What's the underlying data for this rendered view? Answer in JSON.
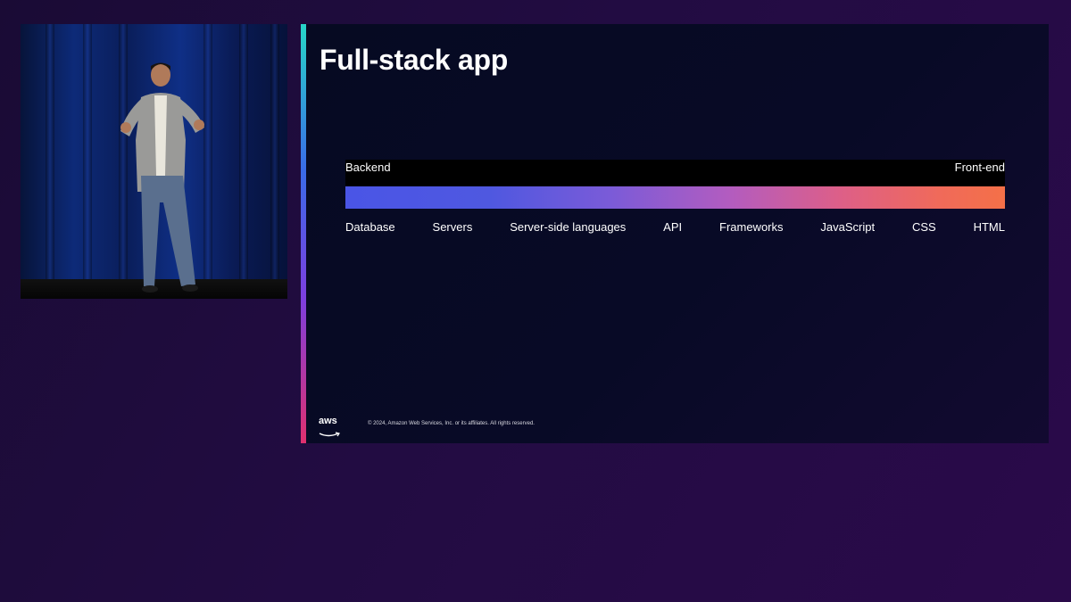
{
  "slide": {
    "title": "Full-stack app",
    "spectrum": {
      "left_label": "Backend",
      "right_label": "Front-end",
      "layers": [
        "Database",
        "Servers",
        "Server-side languages",
        "API",
        "Frameworks",
        "JavaScript",
        "CSS",
        "HTML"
      ]
    },
    "footer": {
      "logo_text": "aws",
      "copyright": "© 2024, Amazon Web Services, Inc. or its affiliates. All rights reserved."
    }
  },
  "colors": {
    "accent_top": "#27d7c8",
    "accent_bottom": "#e0306e",
    "gradient_start": "#4a55e6",
    "gradient_end": "#f47048"
  }
}
